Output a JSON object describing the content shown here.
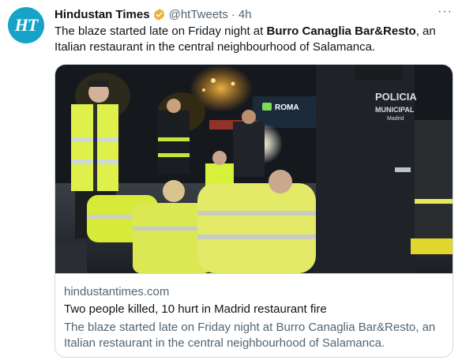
{
  "author": {
    "avatar_text": "HT",
    "display_name": "Hindustan Times",
    "verified_badge_icon": "gold-verified-badge-icon",
    "handle": "@htTweets",
    "separator": "·",
    "time": "4h",
    "more_icon": "more-options-icon",
    "more_glyph": "···"
  },
  "tweet": {
    "text_before": "The blaze started late on Friday night at ",
    "text_bold": "Burro Canaglia Bar&Resto",
    "text_after": ", an Italian restaurant in the central neighbourhood of Salamanca."
  },
  "card": {
    "domain": "hindustantimes.com",
    "title": "Two people killed, 10 hurt in Madrid restaurant fire",
    "description": "The blaze started late on Friday night at Burro Canaglia Bar&Resto, an Italian restaurant in the central neighbourhood of Salamanca.",
    "image": {
      "sign_roma": "ROMA",
      "police_text_line1": "POLICIA",
      "police_text_line2": "MUNICIPAL",
      "police_text_line3": "Madrid"
    }
  },
  "colors": {
    "brand_avatar": "#16a3c7",
    "verified_gold": "#e8b33a",
    "text_secondary": "#536471",
    "border": "#cfd9de"
  }
}
